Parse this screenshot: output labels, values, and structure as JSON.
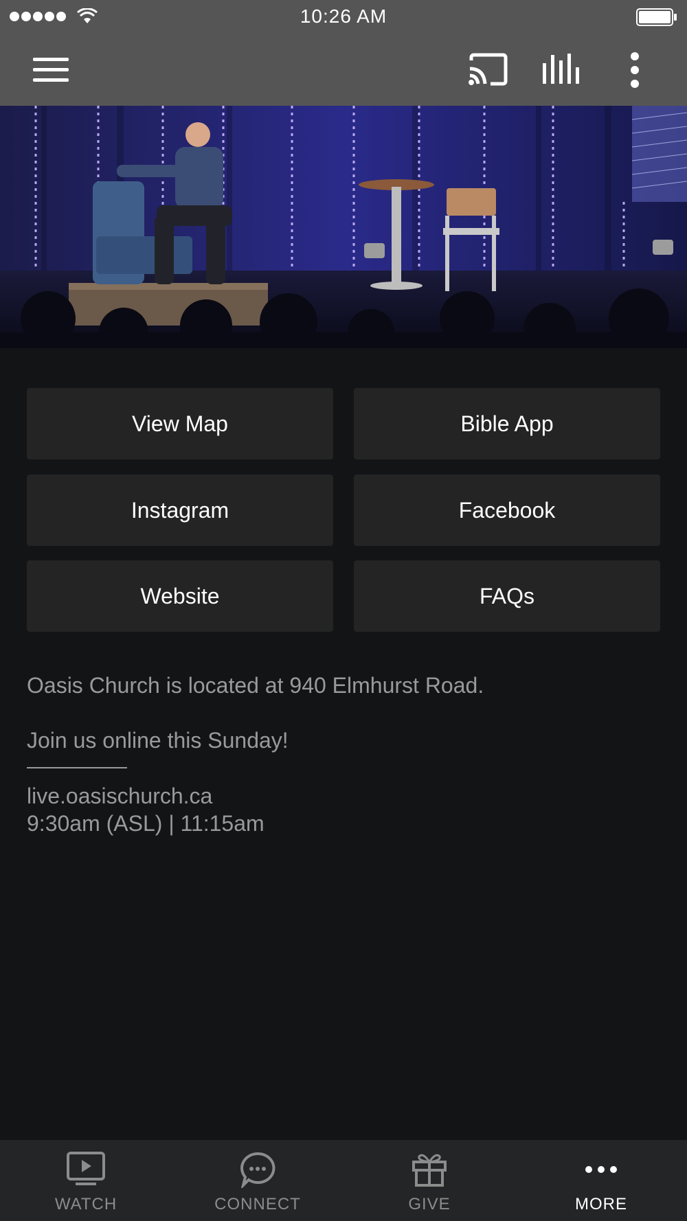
{
  "status_bar": {
    "time": "10:26 AM"
  },
  "buttons": [
    {
      "label": "View Map"
    },
    {
      "label": "Bible App"
    },
    {
      "label": "Instagram"
    },
    {
      "label": "Facebook"
    },
    {
      "label": "Website"
    },
    {
      "label": "FAQs"
    }
  ],
  "info": {
    "line1": "Oasis Church is located at 940 Elmhurst Road.",
    "line2": "Join us online this Sunday!",
    "line3": "live.oasischurch.ca",
    "line4": "9:30am (ASL) | 11:15am"
  },
  "tabs": [
    {
      "label": "WATCH",
      "icon": "tv-play-icon"
    },
    {
      "label": "CONNECT",
      "icon": "chat-bubble-icon"
    },
    {
      "label": "GIVE",
      "icon": "gift-icon"
    },
    {
      "label": "MORE",
      "icon": "more-dots-icon"
    }
  ],
  "colors": {
    "app_bar": "#555555",
    "background": "#131416",
    "button": "#242424",
    "tab_bar": "#242527",
    "muted_text": "#9a9a9a"
  }
}
